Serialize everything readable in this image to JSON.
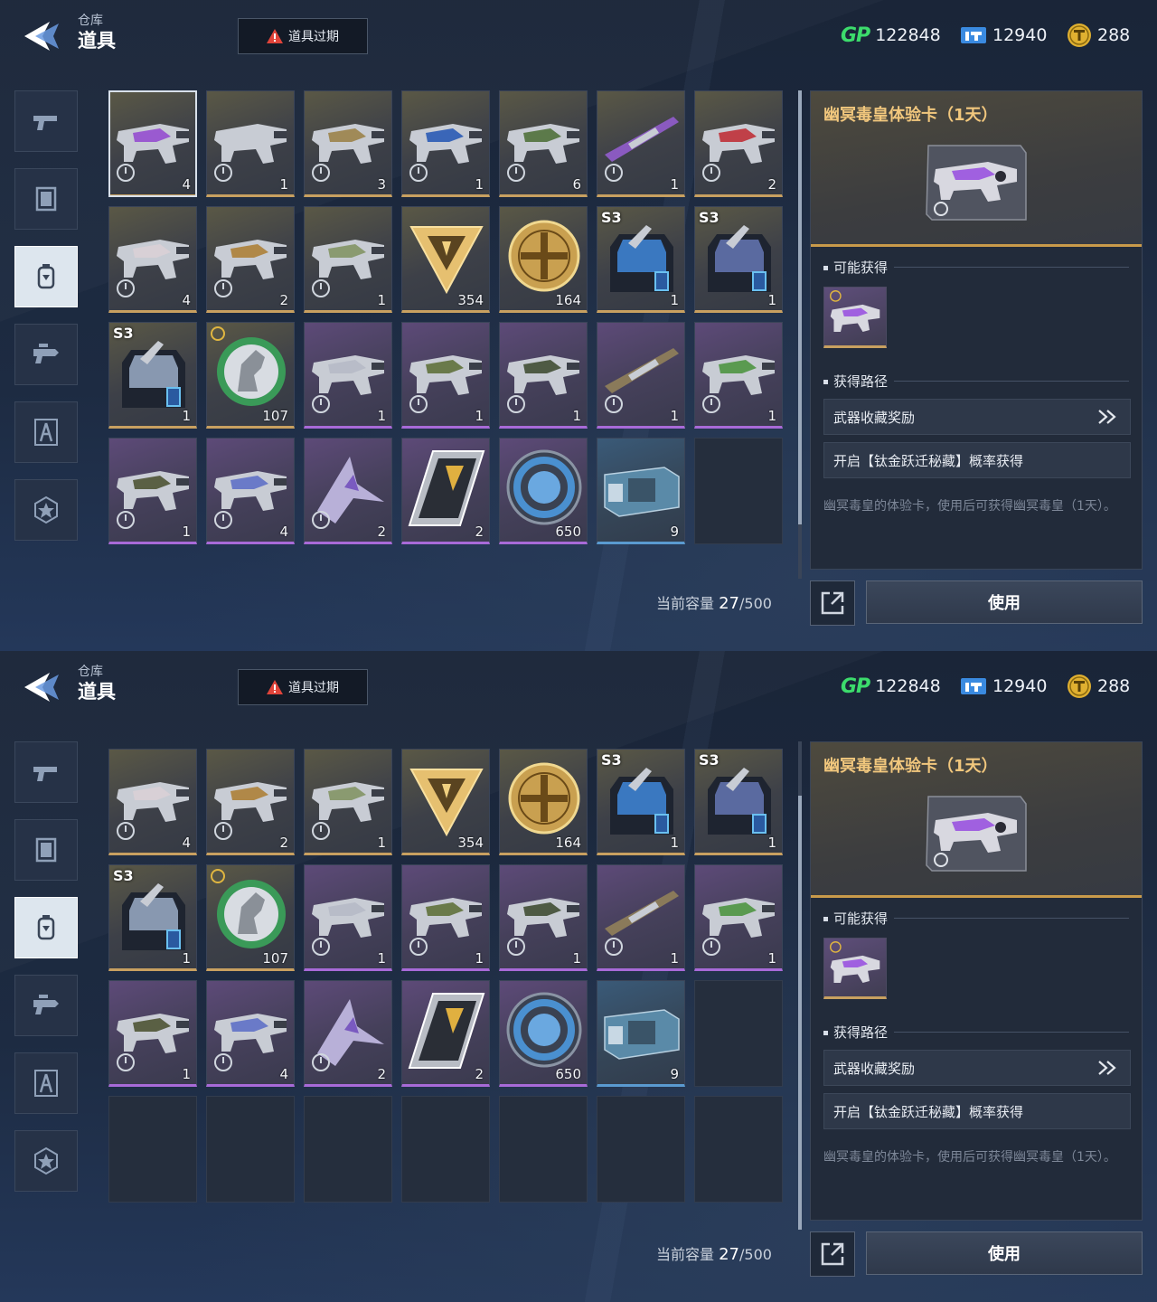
{
  "header": {
    "parent": "仓库",
    "title": "道具",
    "expire_button": "道具过期"
  },
  "currency": {
    "gp_label": "GP",
    "gp": "122848",
    "tickets": "12940",
    "coins": "288"
  },
  "tabs": [
    {
      "icon": "pistol-icon"
    },
    {
      "icon": "frame-icon"
    },
    {
      "icon": "item-bag-icon",
      "active": true
    },
    {
      "icon": "weapon-mod-icon"
    },
    {
      "icon": "character-icon"
    },
    {
      "icon": "star-badge-icon"
    }
  ],
  "items": [
    {
      "qty": "4",
      "rarity": "gold",
      "kind": "gun",
      "color": "#9a5ad0",
      "timer": true
    },
    {
      "qty": "1",
      "rarity": "gold",
      "kind": "gun",
      "color": "#c8ccd4",
      "timer": true
    },
    {
      "qty": "3",
      "rarity": "gold",
      "kind": "gun",
      "color": "#a08a58",
      "timer": true
    },
    {
      "qty": "1",
      "rarity": "gold",
      "kind": "gun",
      "color": "#3a66b8",
      "timer": true
    },
    {
      "qty": "6",
      "rarity": "gold",
      "kind": "gun",
      "color": "#5c7a4a",
      "timer": true
    },
    {
      "qty": "1",
      "rarity": "gold",
      "kind": "rifle",
      "color": "#8a5ac0",
      "timer": true
    },
    {
      "qty": "2",
      "rarity": "gold",
      "kind": "gun",
      "color": "#c04048",
      "timer": true
    },
    {
      "qty": "4",
      "rarity": "gold",
      "kind": "gun",
      "color": "#d8d0d6",
      "timer": true
    },
    {
      "qty": "2",
      "rarity": "gold",
      "kind": "gun",
      "color": "#b08848",
      "timer": true
    },
    {
      "qty": "1",
      "rarity": "gold",
      "kind": "gun",
      "color": "#8a9a70",
      "timer": true
    },
    {
      "qty": "354",
      "rarity": "gold",
      "kind": "triangle",
      "color": "#e6c070"
    },
    {
      "qty": "164",
      "rarity": "gold",
      "kind": "medal",
      "color": "#c9a050"
    },
    {
      "qty": "1",
      "rarity": "gold",
      "kind": "backpack",
      "color": "#3a78c0",
      "season": "S3"
    },
    {
      "qty": "1",
      "rarity": "gold",
      "kind": "backpack",
      "color": "#5a6aa0",
      "season": "S3"
    },
    {
      "qty": "1",
      "rarity": "gold",
      "kind": "backpack",
      "color": "#8898b0",
      "season": "S3"
    },
    {
      "qty": "107",
      "rarity": "gold",
      "kind": "horse",
      "color": "#3a9a58",
      "gold_timer": true
    },
    {
      "qty": "1",
      "rarity": "purple",
      "kind": "gun",
      "color": "#b8bcc8",
      "timer": true
    },
    {
      "qty": "1",
      "rarity": "purple",
      "kind": "gun",
      "color": "#6a7a4a",
      "timer": true
    },
    {
      "qty": "1",
      "rarity": "purple",
      "kind": "gun",
      "color": "#4e5a44",
      "timer": true
    },
    {
      "qty": "1",
      "rarity": "purple",
      "kind": "rifle",
      "color": "#8a7a5a",
      "timer": true
    },
    {
      "qty": "1",
      "rarity": "purple",
      "kind": "gun",
      "color": "#5a9a50",
      "timer": true
    },
    {
      "qty": "1",
      "rarity": "purple",
      "kind": "gun",
      "color": "#5a6044",
      "timer": true
    },
    {
      "qty": "4",
      "rarity": "purple",
      "kind": "gun",
      "color": "#6a7ac8",
      "timer": true
    },
    {
      "qty": "2",
      "rarity": "purple",
      "kind": "blade",
      "color": "#b8b0d8",
      "timer": true
    },
    {
      "qty": "2",
      "rarity": "purple",
      "kind": "card",
      "color": "#e0b040"
    },
    {
      "qty": "650",
      "rarity": "purple",
      "kind": "ring",
      "color": "#4a90d0"
    },
    {
      "qty": "9",
      "rarity": "blue",
      "kind": "crate",
      "color": "#5a8aa8"
    }
  ],
  "capacity": {
    "label": "当前容量",
    "used": "27",
    "total": "/500"
  },
  "detail": {
    "title": "幽冥毒皇体验卡（1天）",
    "possible_label": "可能获得",
    "route_label": "获得路径",
    "routes": [
      "武器收藏奖励",
      "开启【钛金跃迁秘藏】概率获得"
    ],
    "description": "幽冥毒皇的体验卡，使用后可获得幽冥毒皇（1天）。",
    "use_button": "使用"
  }
}
